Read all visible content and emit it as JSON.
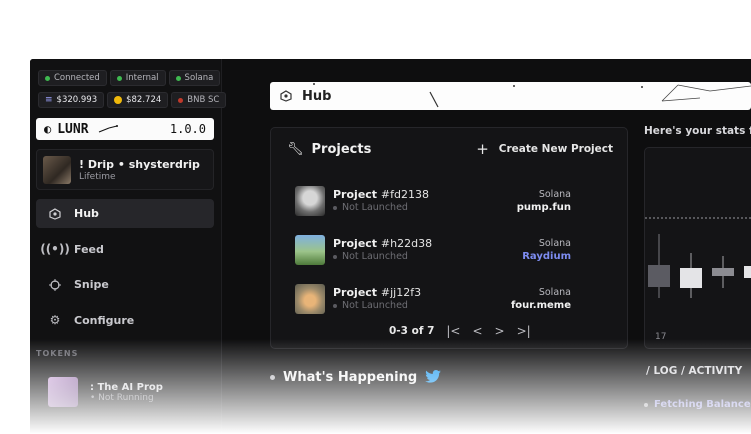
{
  "status_chips": [
    {
      "label": "Connected",
      "dot_color": "#3fb950"
    },
    {
      "label": "Internal",
      "dot_color": "#3fb950"
    },
    {
      "label": "Solana",
      "dot_color": "#3fb950"
    }
  ],
  "balance_chips": [
    {
      "label": "$320.993",
      "icon": "solana-icon"
    },
    {
      "label": "$82.724",
      "icon": "bnb-coin-icon"
    },
    {
      "label": "BNB SC",
      "icon": "status-dot"
    }
  ],
  "brand": {
    "name": "LUNR",
    "version": "1.0.0"
  },
  "profile": {
    "name": "! Drip • shysterdrip",
    "subtitle": "Lifetime"
  },
  "nav": [
    {
      "label": "Hub",
      "icon": "hub-icon",
      "active": true
    },
    {
      "label": "Feed",
      "icon": "broadcast-icon",
      "active": false
    },
    {
      "label": "Snipe",
      "icon": "crosshair-icon",
      "active": false
    },
    {
      "label": "Configure",
      "icon": "gear-icon",
      "active": false
    }
  ],
  "tokens": {
    "section_label": "TOKENS",
    "items": [
      {
        "name": ": The AI Prop",
        "status": "Not Running"
      }
    ]
  },
  "hubbar": {
    "title": "Hub"
  },
  "projects": {
    "title": "Projects",
    "create_label": "Create New Project",
    "rows": [
      {
        "name": "Project",
        "hash": "#fd2138",
        "status": "Not Launched",
        "chain": "Solana",
        "platform": "pump.fun",
        "platform_color": "#f2f2f2"
      },
      {
        "name": "Project",
        "hash": "#h22d38",
        "status": "Not Launched",
        "chain": "Solana",
        "platform": "Raydium",
        "platform_color": "#7d8cf0"
      },
      {
        "name": "Project",
        "hash": "#jj12f3",
        "status": "Not Launched",
        "chain": "Solana",
        "platform": "four.meme",
        "platform_color": "#f2f2f2"
      }
    ],
    "pager": {
      "range": "0-3 of 7"
    }
  },
  "stats": {
    "title": "Here's your stats fr",
    "axis_label": "17"
  },
  "happening": {
    "title": "What's Happening"
  },
  "log": {
    "title": "/ LOG / ACTIVITY",
    "items": [
      "Fetching Balances"
    ]
  }
}
